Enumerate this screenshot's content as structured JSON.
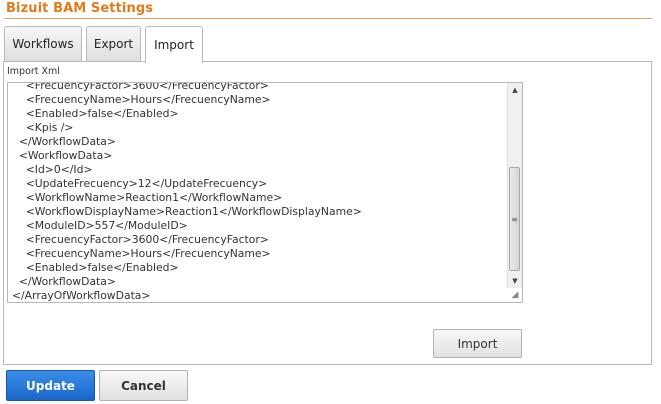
{
  "header": {
    "title": "Bizuit BAM Settings"
  },
  "tabs": [
    {
      "label": "Workflows"
    },
    {
      "label": "Export"
    },
    {
      "label": "Import"
    }
  ],
  "import_panel": {
    "field_label": "Import Xml",
    "xml_text": "    <FrecuencyFactor>3600</FrecuencyFactor>\n    <FrecuencyName>Hours</FrecuencyName>\n    <Enabled>false</Enabled>\n    <Kpis />\n  </WorkflowData>\n  <WorkflowData>\n    <Id>0</Id>\n    <UpdateFrecuency>12</UpdateFrecuency>\n    <WorkflowName>Reaction1</WorkflowName>\n    <WorkflowDisplayName>Reaction1</WorkflowDisplayName>\n    <ModuleID>557</ModuleID>\n    <FrecuencyFactor>3600</FrecuencyFactor>\n    <FrecuencyName>Hours</FrecuencyName>\n    <Enabled>false</Enabled>\n  </WorkflowData>\n</ArrayOfWorkflowData>",
    "import_button": "Import"
  },
  "footer": {
    "update_button": "Update",
    "cancel_button": "Cancel"
  },
  "icons": {
    "scroll_up": "triangle-up",
    "scroll_down": "triangle-down",
    "scroll_thumb_grip": "grip-lines",
    "resize": "resize-grip"
  },
  "colors": {
    "title": "#e07b1c",
    "primary_button": "#1a66c9"
  }
}
